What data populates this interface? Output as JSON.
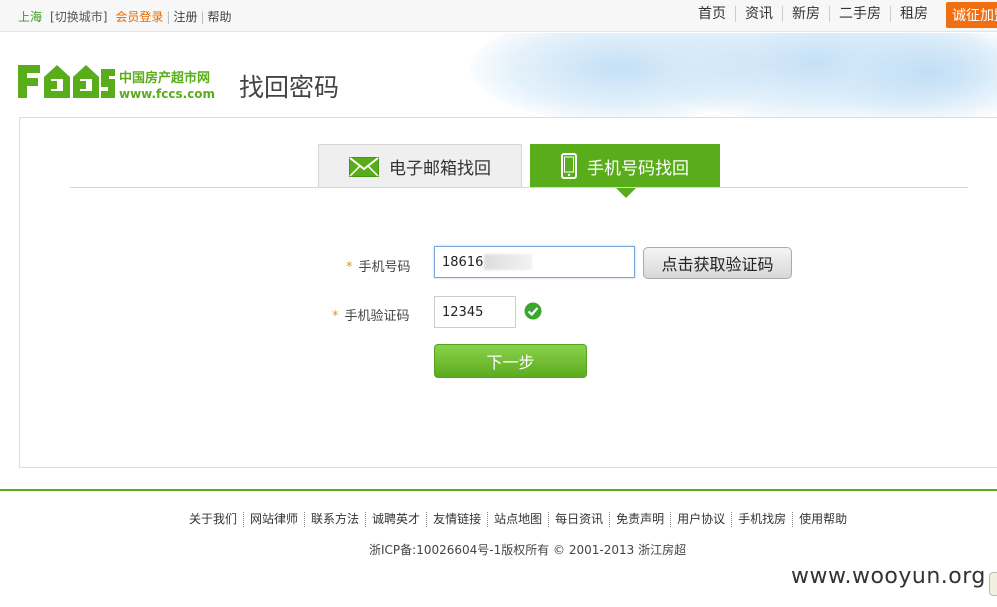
{
  "topbar": {
    "city": "上海",
    "switch_city": "[切换城市]",
    "member_login": "会员登录",
    "register": "注册",
    "help": "帮助",
    "nav": [
      "首页",
      "资讯",
      "新房",
      "二手房",
      "租房"
    ],
    "promo": "诚征加盟"
  },
  "header": {
    "logo_text_cn": "中国房产超市网",
    "logo_text_url": "www.fccs.com",
    "logo_letters": "FCCS",
    "page_title": "找回密码"
  },
  "tabs": [
    {
      "label": "电子邮箱找回",
      "icon": "envelope-icon",
      "active": false
    },
    {
      "label": "手机号码找回",
      "icon": "mobile-phone-icon",
      "active": true
    }
  ],
  "form": {
    "phone_label": "手机号码",
    "phone_value": "18616",
    "get_code_label": "点击获取验证码",
    "code_label": "手机验证码",
    "code_value": "12345",
    "required_mark": "*",
    "next_label": "下一步"
  },
  "footer": {
    "links": [
      "关于我们",
      "网站律师",
      "联系方法",
      "诚聘英才",
      "友情链接",
      "站点地图",
      "每日资讯",
      "免责声明",
      "用户协议",
      "手机找房",
      "使用帮助"
    ],
    "copyright": "浙ICP备:10026604号-1版权所有 © 2001-2013 浙江房超"
  },
  "watermark": "www.wooyun.org",
  "colors": {
    "brand_green": "#5aad1a",
    "accent_orange": "#f06f12",
    "required_star": "#f39800"
  }
}
